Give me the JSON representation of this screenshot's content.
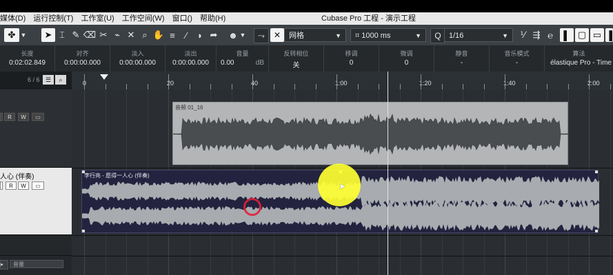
{
  "menu": {
    "items": [
      "媒体(D)",
      "运行控制(T)",
      "工作室(U)",
      "工作空间(W)",
      "窗口()",
      "帮助(H)"
    ],
    "window_title": "Cubase Pro 工程 - 演示工程"
  },
  "toolbar": {
    "grid_type": "网格",
    "grid_length": "1000 ms",
    "quantize": "1/16"
  },
  "info_line": [
    {
      "label": "长度",
      "value": "0:02:02.849"
    },
    {
      "label": "对齐",
      "value": "0:00:00.000"
    },
    {
      "label": "淡入",
      "value": "0:00:00.000"
    },
    {
      "label": "淡出",
      "value": "0:00:00.000"
    },
    {
      "label": "音量",
      "value": "0.00",
      "unit": "dB"
    },
    {
      "label": "反转相位",
      "value": "关"
    },
    {
      "label": "移调",
      "value": "0"
    },
    {
      "label": "微调",
      "value": "0"
    },
    {
      "label": "静音",
      "value": "-"
    },
    {
      "label": "音乐模式",
      "value": "-"
    },
    {
      "label": "算法",
      "value": "élastique Pro - Time"
    }
  ],
  "track_header": {
    "count": "6 / 6"
  },
  "ruler": {
    "labels": [
      "0",
      "20",
      "40",
      "1:00",
      "1:20",
      "1:40",
      "2:00"
    ]
  },
  "tracks": [
    {
      "name": "",
      "event_name": "音频 01_16"
    },
    {
      "name": "人心 (伴奏)",
      "event_name": "李行亮 - 愿得一人心 (伴奏)"
    }
  ],
  "track_buttons": {
    "r": "R",
    "w": "W"
  },
  "bottom_track": {
    "label": "音量"
  },
  "colors": {
    "event_blue": "#23233f",
    "event_wave": "#a8acb0",
    "event_gray": "#b3b5b7",
    "cursor_yellow": "#ffff33",
    "click_red": "#e0203a"
  }
}
